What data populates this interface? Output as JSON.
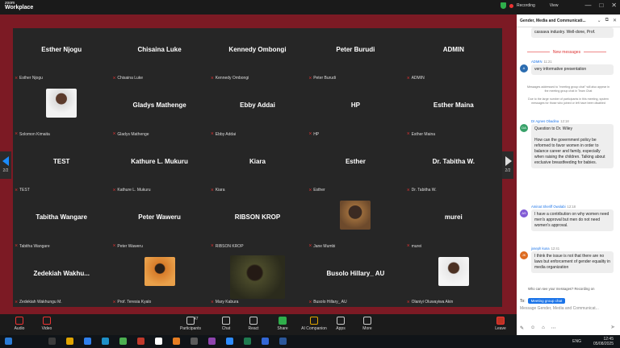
{
  "titlebar": {
    "app_line1": "zoom",
    "app_line2": "Workplace",
    "recording_label": "Recording",
    "view_label": "View",
    "window_controls": [
      "—",
      "□",
      "✕"
    ]
  },
  "grid": {
    "tiles": [
      {
        "big": "Esther Njogu",
        "small": "Esther Njogu",
        "photo": ""
      },
      {
        "big": "Chisaina Luke",
        "small": "Chisaina Luke",
        "photo": ""
      },
      {
        "big": "Kennedy Ombongi",
        "small": "Kennedy Ombongi",
        "photo": ""
      },
      {
        "big": "Peter Burudi",
        "small": "Peter Burudi",
        "photo": ""
      },
      {
        "big": "ADMIN",
        "small": "ADMIN",
        "photo": ""
      },
      {
        "big": "",
        "small": "Solomon Kimaita",
        "photo": "p1"
      },
      {
        "big": "Gladys Mathenge",
        "small": "Gladys Mathenge",
        "photo": ""
      },
      {
        "big": "Ebby Addai",
        "small": "Ebby Addai",
        "photo": ""
      },
      {
        "big": "HP",
        "small": "HP",
        "photo": ""
      },
      {
        "big": "Esther Maina",
        "small": "Esther Maina",
        "photo": ""
      },
      {
        "big": "TEST",
        "small": "TEST",
        "photo": ""
      },
      {
        "big": "Kathure L. Mukuru",
        "small": "Kathure L. Mukuru",
        "photo": ""
      },
      {
        "big": "Kiara",
        "small": "Kiara",
        "photo": ""
      },
      {
        "big": "Esther",
        "small": "Esther",
        "photo": ""
      },
      {
        "big": "Dr. Tabitha W.",
        "small": "Dr. Tabitha W.",
        "photo": ""
      },
      {
        "big": "Tabitha Wangare",
        "small": "Tabitha Wangare",
        "photo": ""
      },
      {
        "big": "Peter Waweru",
        "small": "Peter Waweru",
        "photo": ""
      },
      {
        "big": "RIBSON KROP",
        "small": "RIBSON KROP",
        "photo": ""
      },
      {
        "big": "",
        "small": "Jane Mumbi",
        "photo": "p2"
      },
      {
        "big": "murei",
        "small": "murei",
        "photo": ""
      },
      {
        "big": "Zedekiah Wakhu...",
        "small": "Zedekiah Wakhungu M.",
        "photo": ""
      },
      {
        "big": "",
        "small": "Prof. Teresia Kyalo",
        "photo": "p3"
      },
      {
        "big": "",
        "small": "Mary Kabura",
        "photo": "p4"
      },
      {
        "big": "Busolo Hillary_ AU",
        "small": "Busolo Hillary_ AU",
        "photo": ""
      },
      {
        "big": "",
        "small": "Olaniyi Oluwayiwa Akin",
        "photo": "p5"
      }
    ],
    "page_left": "2/2",
    "page_right": "2/2"
  },
  "toolbar": {
    "audio": "Audio",
    "video": "Video",
    "participants": "Participants",
    "participants_count": "47",
    "chat": "Chat",
    "react": "React",
    "share": "Share",
    "ai_companion": "AI Companion",
    "apps": "Apps",
    "more": "More",
    "leave": "Leave"
  },
  "chat": {
    "header": "Gender, Media and Communicati...",
    "prev_fragment": "cassava industry. Well-done, Prof.",
    "new_messages": "New messages",
    "messages": [
      {
        "name": "ADMIN",
        "time": "11:21",
        "initials": "A",
        "color": "#2b6cb0",
        "text": "very informative presentation"
      },
      {
        "name": "Dr Agnes Obadina",
        "time": "12:18",
        "initials": "DA",
        "color": "#38a169",
        "text": "Question to Dr. Wiley\n\nHow can the government policy be reformed to favor women in order to balance career and family, especially when raising the children. Talking about exclusive breastfeeding for babies."
      },
      {
        "name": "Aminat Sheriff Owolabi",
        "time": "12:18",
        "initials": "AS",
        "color": "#805ad5",
        "text": "I have a contribution on why women need men's approval but men do not need women's approval."
      },
      {
        "name": "joseph kuna",
        "time": "12:41",
        "initials": "JK",
        "color": "#dd6b20",
        "text": "I think the issue is not that there are no laws but enforcement of gender equality in media organization"
      }
    ],
    "system_note": "Messages addressed to \"meeting group chat\" will also appear in the meeting group chat in Team Chat\n\nDue to the large number of participants in this meeting, system messages for those who joined or left have been disabled",
    "who_can_see": "Who can see your messages? Recording on",
    "to_label": "To:",
    "to_value": "Meeting group chat",
    "placeholder": "Message Gender, Media and Communicat..."
  },
  "taskbar": {
    "lang": "ENG",
    "time": "12:45",
    "date": "05/08/2025"
  }
}
